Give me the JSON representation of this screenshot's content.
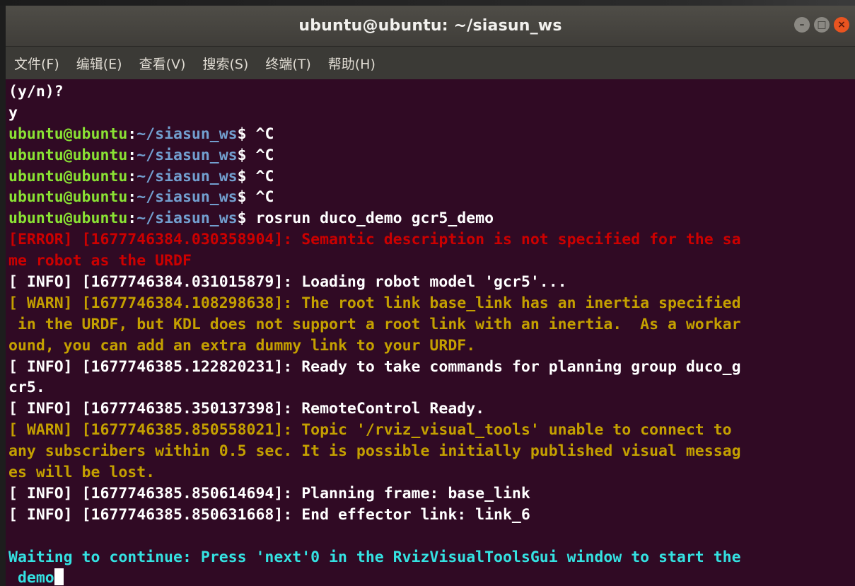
{
  "window": {
    "title": "ubuntu@ubuntu: ~/siasun_ws",
    "buttons": {
      "minimize": "–",
      "maximize": "□",
      "close": "×"
    }
  },
  "menu": {
    "items": [
      "文件(F)",
      "编辑(E)",
      "查看(V)",
      "搜索(S)",
      "终端(T)",
      "帮助(H)"
    ]
  },
  "terminal": {
    "prompt_user": "ubuntu@ubuntu",
    "prompt_path": "~/siasun_ws",
    "lines": {
      "l1": "(y/n)?",
      "l2": "y",
      "ctrl_c": "^C",
      "command": "rosrun duco_demo gcr5_demo",
      "error1": "[ERROR] [1677746384.030358904]: Semantic description is not specified for the sa",
      "error2": "me robot as the URDF",
      "info1": "[ INFO] [1677746384.031015879]: Loading robot model 'gcr5'...",
      "warn1a": "[ WARN] [1677746384.108298638]: The root link base_link has an inertia specified",
      "warn1b": " in the URDF, but KDL does not support a root link with an inertia.  As a workar",
      "warn1c": "ound, you can add an extra dummy link to your URDF.",
      "info2a": "[ INFO] [1677746385.122820231]: Ready to take commands for planning group duco_g",
      "info2b": "cr5.",
      "info3": "[ INFO] [1677746385.350137398]: RemoteControl Ready.",
      "warn2a": "[ WARN] [1677746385.850558021]: Topic '/rviz_visual_tools' unable to connect to",
      "warn2b": "any subscribers within 0.5 sec. It is possible initially published visual messag",
      "warn2c": "es will be lost.",
      "info4": "[ INFO] [1677746385.850614694]: Planning frame: base_link",
      "info5": "[ INFO] [1677746385.850631668]: End effector link: link_6",
      "wait1": "Waiting to continue: Press 'next'0 in the RvizVisualToolsGui window to start the",
      "wait2": " demo"
    }
  },
  "colors": {
    "background": "#300a24",
    "prompt_user": "#8ae234",
    "prompt_path": "#729fcf",
    "error": "#cc0000",
    "warn": "#c4a000",
    "waiting": "#34e2e2"
  }
}
